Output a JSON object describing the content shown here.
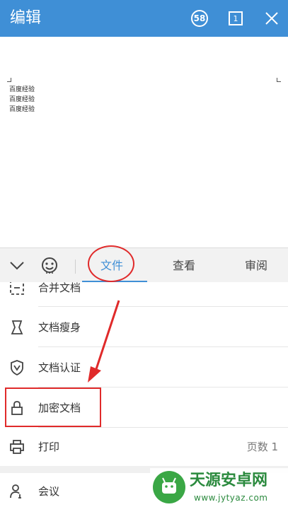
{
  "header": {
    "title": "编辑",
    "badge_value": "58",
    "page_indicator": "1"
  },
  "document": {
    "lines": [
      "百度经验",
      "百度经验",
      "百度经验"
    ]
  },
  "tabs": [
    {
      "label": "文件",
      "active": true
    },
    {
      "label": "查看",
      "active": false
    },
    {
      "label": "审阅",
      "active": false
    }
  ],
  "menu": {
    "items": [
      {
        "label": "合并文档",
        "icon": "merge-icon"
      },
      {
        "label": "文档瘦身",
        "icon": "slim-icon"
      },
      {
        "label": "文档认证",
        "icon": "shield-v-icon"
      },
      {
        "label": "加密文档",
        "icon": "lock-icon"
      },
      {
        "label": "打印",
        "icon": "printer-icon",
        "right": "页数 1"
      },
      {
        "label": "会议",
        "icon": "meeting-user-icon"
      }
    ]
  },
  "watermark": {
    "main": "天源安卓网",
    "sub": "www.jytyaz.com"
  },
  "colors": {
    "header_bg": "#3f8fd6",
    "accent": "#3f8fd6",
    "highlight": "#e02a2a"
  }
}
